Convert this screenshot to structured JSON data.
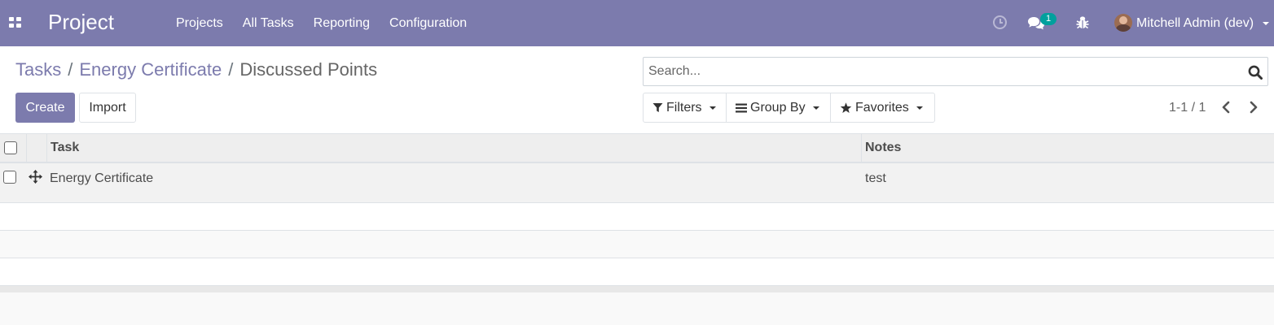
{
  "navbar": {
    "brand": "Project",
    "menu": [
      "Projects",
      "All Tasks",
      "Reporting",
      "Configuration"
    ],
    "chat_count": "1",
    "user": "Mitchell Admin (dev)",
    "color": "#7c7bad"
  },
  "breadcrumb": {
    "items": [
      "Tasks",
      "Energy Certificate"
    ],
    "separator": "/",
    "current": "Discussed Points"
  },
  "buttons": {
    "create": "Create",
    "import": "Import"
  },
  "search": {
    "placeholder": "Search...",
    "filters": "Filters",
    "group_by": "Group By",
    "favorites": "Favorites"
  },
  "pager": {
    "value": "1-1 / 1"
  },
  "table": {
    "columns": [
      "Task",
      "Notes"
    ],
    "rows": [
      {
        "task": "Energy Certificate",
        "notes": "test"
      }
    ]
  }
}
